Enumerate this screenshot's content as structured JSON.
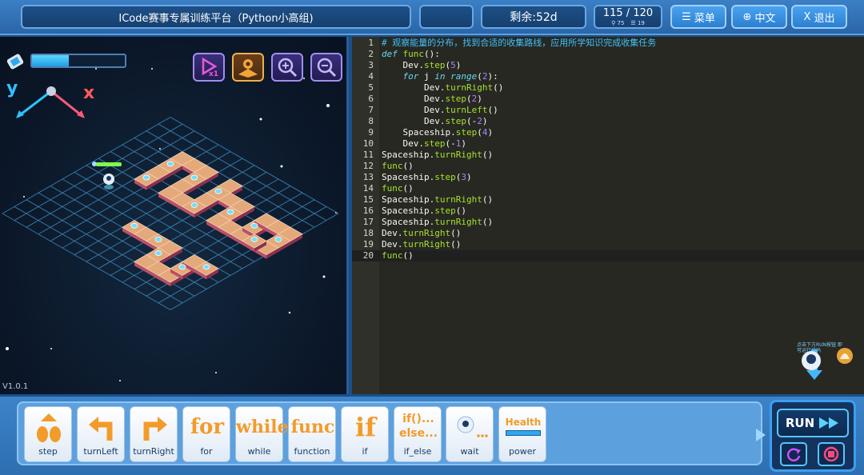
{
  "topbar": {
    "title": "ICode赛事专属训练平台（Python小高组)",
    "remaining": "剩余:52d",
    "score": "115 / 120",
    "score_sub_a": "75",
    "score_sub_b": "19",
    "menu_label": "菜单",
    "lang_label": "中文",
    "exit_label": "退出"
  },
  "game": {
    "version": "V1.0.1",
    "axis_y": "y",
    "axis_x": "x",
    "energy_level": 0.4
  },
  "editor": {
    "lines": [
      "# 观察能量的分布，找到合适的收集路线，应用所学知识完成收集任务",
      "def func():",
      "    Dev.step(5)",
      "    for j in range(2):",
      "        Dev.turnRight()",
      "        Dev.step(2)",
      "        Dev.turnLeft()",
      "        Dev.step(-2)",
      "    Spaceship.step(4)",
      "    Dev.step(-1)",
      "Spaceship.turnRight()",
      "func()",
      "Spaceship.step(3)",
      "func()",
      "Spaceship.turnRight()",
      "Spaceship.step()",
      "Spaceship.turnRight()",
      "Dev.turnRight()",
      "Dev.turnRight()",
      "func()"
    ],
    "active_line": 20,
    "helper_text": "点击下方RUN按钮 即可运行代码"
  },
  "palette": {
    "blocks": [
      {
        "label": "step",
        "glyph": ""
      },
      {
        "label": "turnLeft",
        "glyph": ""
      },
      {
        "label": "turnRight",
        "glyph": ""
      },
      {
        "label": "for",
        "glyph": "for"
      },
      {
        "label": "while",
        "glyph": "while"
      },
      {
        "label": "function",
        "glyph": "func"
      },
      {
        "label": "if",
        "glyph": "if"
      },
      {
        "label": "if_else",
        "glyph": "if()...else..."
      },
      {
        "label": "wait",
        "glyph": ""
      },
      {
        "label": "power",
        "glyph": "Health"
      }
    ]
  },
  "run": {
    "label": "RUN"
  },
  "colors": {
    "accent": "#3a9ff0",
    "block_orange": "#f39b2a",
    "editor_bg": "#272822"
  }
}
